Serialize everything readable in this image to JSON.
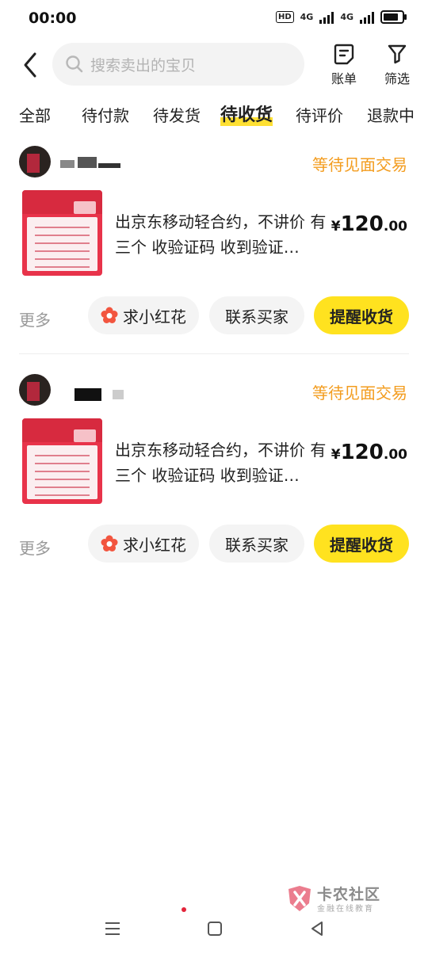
{
  "status_bar": {
    "time": "00:00",
    "hd": "HD",
    "net1": "4G",
    "net2": "4G"
  },
  "search": {
    "placeholder": "搜索卖出的宝贝",
    "icon": "search-icon"
  },
  "toolbar": {
    "bill_label": "账单",
    "filter_label": "筛选"
  },
  "tabs": [
    {
      "label": "全部"
    },
    {
      "label": "待付款"
    },
    {
      "label": "待发货"
    },
    {
      "label": "待收货",
      "active": true
    },
    {
      "label": "待评价"
    },
    {
      "label": "退款中"
    }
  ],
  "orders": [
    {
      "status": "等待见面交易",
      "title": "出京东移动轻合约，不讲价 有三个 收验证码 收到验证…",
      "price_symbol": "¥",
      "price_int": "120",
      "price_dec": ".00",
      "more": "更多",
      "actions": {
        "flower": "求小红花",
        "contact": "联系买家",
        "remind": "提醒收货"
      }
    },
    {
      "status": "等待见面交易",
      "title": "出京东移动轻合约，不讲价 有三个 收验证码 收到验证…",
      "price_symbol": "¥",
      "price_int": "120",
      "price_dec": ".00",
      "more": "更多",
      "actions": {
        "flower": "求小红花",
        "contact": "联系买家",
        "remind": "提醒收货"
      }
    }
  ],
  "watermark": {
    "line1": "卡农社区",
    "line2": "金融在线教育"
  },
  "colors": {
    "accent_yellow": "#ffe21f",
    "status_orange": "#f39c1e",
    "flower_red": "#f2553f"
  }
}
